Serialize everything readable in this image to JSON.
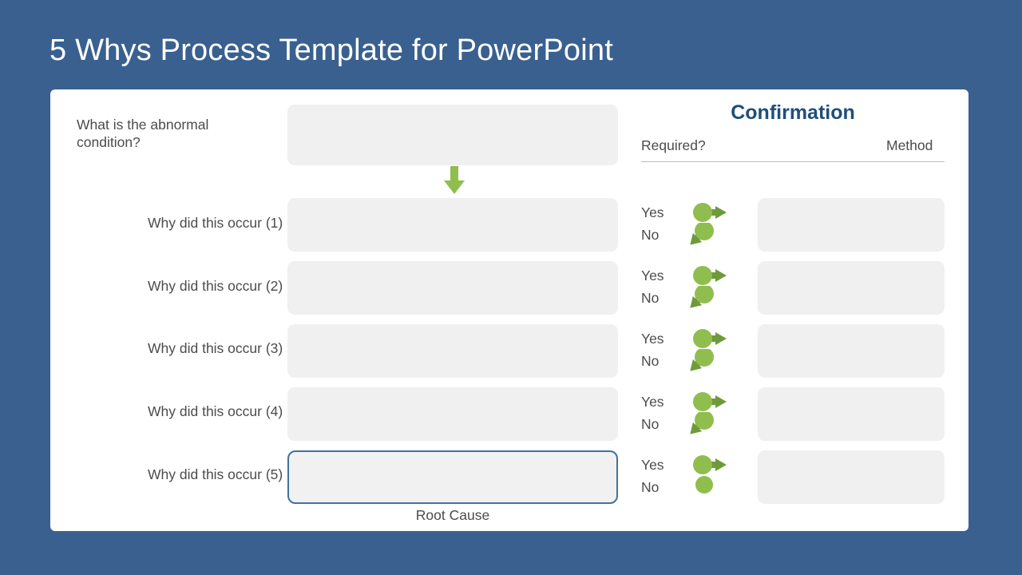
{
  "slide": {
    "title": "5 Whys Process Template for PowerPoint",
    "background_color": "#39608F",
    "card_color": "#FFFFFF"
  },
  "colors": {
    "background_blue": "#39608F",
    "accent_blue": "#1F4E79",
    "root_cause_border": "#41719C",
    "box_gray": "#F0F0F0",
    "text_gray": "#4C4C4C",
    "icon_green_light": "#8FBE4F",
    "icon_green_dark": "#6E9A3C",
    "flow_arrow_green": "#8FBE4F"
  },
  "left_column": {
    "abnormal_label": "What is the abnormal condition?",
    "why_labels": [
      "Why did this occur (1) ?",
      "Why did this occur (2) ?",
      "Why did this occur (3) ?",
      "Why did this occur (4) ?",
      "Why did this occur (5) ?"
    ]
  },
  "middle_column": {
    "abnormal_box_value": "",
    "why_box_values": [
      "",
      "",
      "",
      "",
      ""
    ],
    "root_cause_caption": "Root Cause",
    "flow_arrow_icon": "arrow-down-icon"
  },
  "confirmation": {
    "title": "Confirmation",
    "required_header": "Required?",
    "method_header": "Method",
    "rows": [
      {
        "yes_label": "Yes",
        "no_label": "No",
        "yes_icon": "circle-arrow-right-icon",
        "no_icon": "circle-arrow-down-left-icon",
        "method_value": ""
      },
      {
        "yes_label": "Yes",
        "no_label": "No",
        "yes_icon": "circle-arrow-right-icon",
        "no_icon": "circle-arrow-down-left-icon",
        "method_value": ""
      },
      {
        "yes_label": "Yes",
        "no_label": "No",
        "yes_icon": "circle-arrow-right-icon",
        "no_icon": "circle-arrow-down-left-icon",
        "method_value": ""
      },
      {
        "yes_label": "Yes",
        "no_label": "No",
        "yes_icon": "circle-arrow-right-icon",
        "no_icon": "circle-arrow-down-left-icon",
        "method_value": ""
      },
      {
        "yes_label": "Yes",
        "no_label": "No",
        "yes_icon": "circle-arrow-right-icon",
        "no_icon": "circle-icon",
        "method_value": ""
      }
    ]
  }
}
